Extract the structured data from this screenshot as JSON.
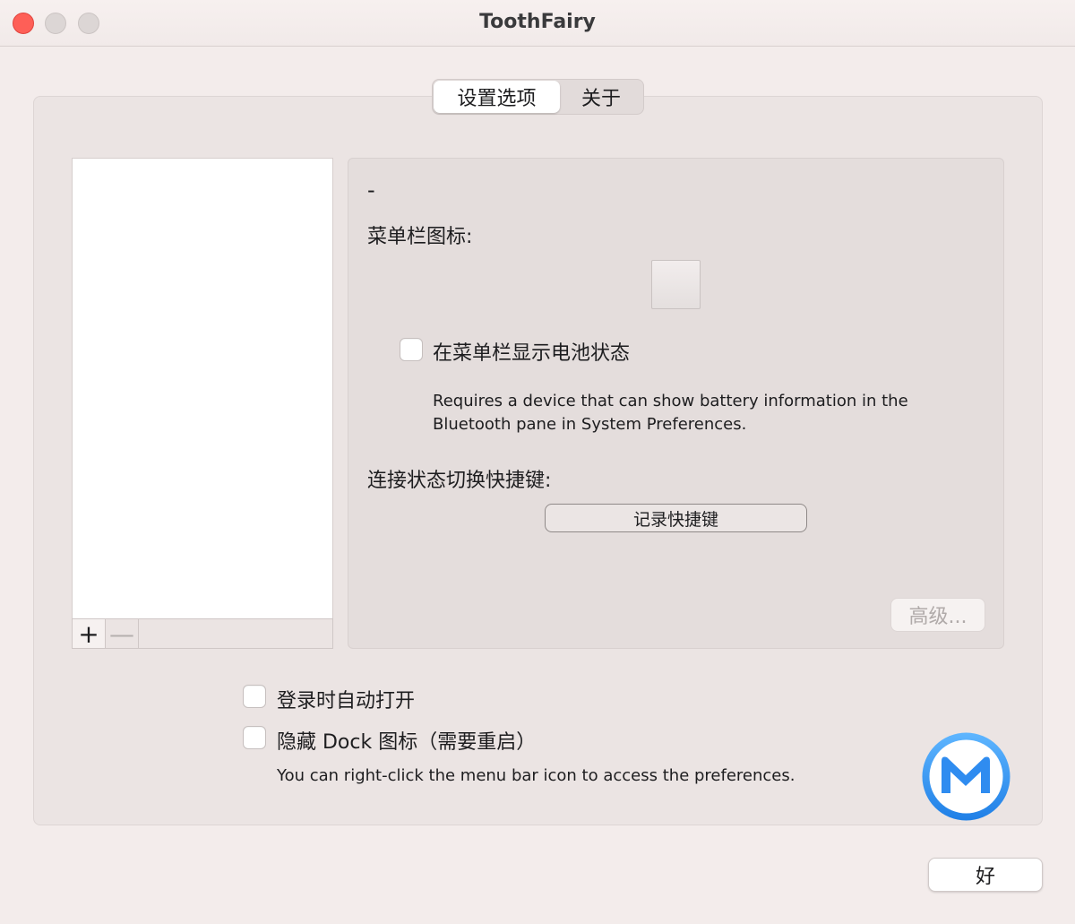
{
  "window": {
    "title": "ToothFairy"
  },
  "tabs": [
    {
      "label": "设置选项",
      "selected": true
    },
    {
      "label": "关于",
      "selected": false
    }
  ],
  "device_list": {
    "add_label": "+",
    "remove_label": "—"
  },
  "detail": {
    "device_name": "-",
    "menubar_icon_label": "菜单栏图标:",
    "show_battery_label": "在菜单栏显示电池状态",
    "show_battery_checked": false,
    "battery_note": "Requires a device that can show battery information in the Bluetooth pane in System Preferences.",
    "shortcut_label": "连接状态切换快捷键:",
    "record_shortcut_label": "记录快捷键",
    "advanced_label": "高级..."
  },
  "general": {
    "launch_at_login_label": "登录时自动打开",
    "launch_at_login_checked": false,
    "hide_dock_label": "隐藏 Dock 图标（需要重启）",
    "hide_dock_checked": false,
    "note": "You can right-click the menu bar icon to access the preferences."
  },
  "footer": {
    "ok_label": "好"
  },
  "icons": {
    "close": "close-icon",
    "minimize": "minimize-icon",
    "maximize": "zoom-icon",
    "logo": "m-logo-icon"
  },
  "colors": {
    "close_button": "#fe5f57",
    "logo_blue": "#2f8cf0"
  }
}
